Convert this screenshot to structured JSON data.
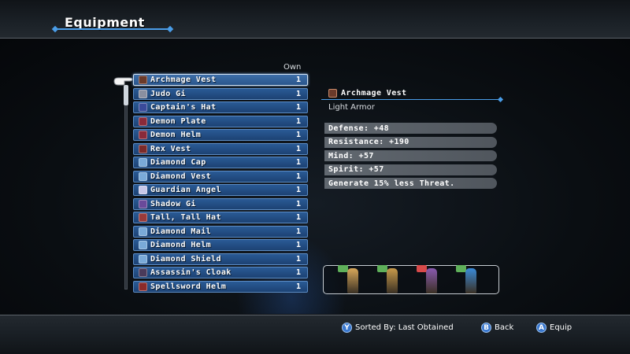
{
  "header": {
    "title": "Equipment"
  },
  "list": {
    "column_own": "Own",
    "items": [
      {
        "name": "Archmage Vest",
        "qty": "1",
        "icon": "vest-icon",
        "color": "#6a3a2a"
      },
      {
        "name": "Judo Gi",
        "qty": "1",
        "icon": "gi-icon",
        "color": "#8a8fa0"
      },
      {
        "name": "Captain's Hat",
        "qty": "1",
        "icon": "hat-icon",
        "color": "#3a4a9a"
      },
      {
        "name": "Demon Plate",
        "qty": "1",
        "icon": "armor-icon",
        "color": "#8a2a3a"
      },
      {
        "name": "Demon Helm",
        "qty": "1",
        "icon": "helm-icon",
        "color": "#8a2a3a"
      },
      {
        "name": "Rex Vest",
        "qty": "1",
        "icon": "vest-icon",
        "color": "#7a2a2a"
      },
      {
        "name": "Diamond Cap",
        "qty": "1",
        "icon": "cap-icon",
        "color": "#7aaad8"
      },
      {
        "name": "Diamond Vest",
        "qty": "1",
        "icon": "vest-icon",
        "color": "#7aaad8"
      },
      {
        "name": "Guardian Angel",
        "qty": "1",
        "icon": "angel-icon",
        "color": "#c8c8e8"
      },
      {
        "name": "Shadow Gi",
        "qty": "1",
        "icon": "gi-icon",
        "color": "#6a4a9a"
      },
      {
        "name": "Tall, Tall Hat",
        "qty": "1",
        "icon": "hat-icon",
        "color": "#9a3a3a"
      },
      {
        "name": "Diamond Mail",
        "qty": "1",
        "icon": "mail-icon",
        "color": "#7aaad8"
      },
      {
        "name": "Diamond Helm",
        "qty": "1",
        "icon": "helm-icon",
        "color": "#7aaad8"
      },
      {
        "name": "Diamond Shield",
        "qty": "1",
        "icon": "shield-icon",
        "color": "#7aaad8"
      },
      {
        "name": "Assassin's Cloak",
        "qty": "1",
        "icon": "cloak-icon",
        "color": "#4a3a5a"
      },
      {
        "name": "Spellsword Helm",
        "qty": "1",
        "icon": "helm-icon",
        "color": "#8a2a2a"
      }
    ]
  },
  "detail": {
    "name": "Archmage Vest",
    "type": "Light Armor",
    "stats": [
      "Defense:  +48",
      "Resistance:  +190",
      "Mind:  +57",
      "Spirit:  +57",
      "Generate 15% less Threat."
    ]
  },
  "party": [
    {
      "indicator": "up-arrow-icon",
      "color": "#5fb05a",
      "sprite": "#d8a85a"
    },
    {
      "indicator": "up-arrow-icon",
      "color": "#5fb05a",
      "sprite": "#c89a4a"
    },
    {
      "indicator": "heart-icon",
      "color": "#d84a4a",
      "sprite": "#8a5ab0"
    },
    {
      "indicator": "up-arrow-icon",
      "color": "#5fb05a",
      "sprite": "#3a8ad8"
    }
  ],
  "footer": {
    "sort_button": "Y",
    "sort_label": "Sorted By: Last Obtained",
    "back_button": "B",
    "back_label": "Back",
    "equip_button": "A",
    "equip_label": "Equip"
  }
}
